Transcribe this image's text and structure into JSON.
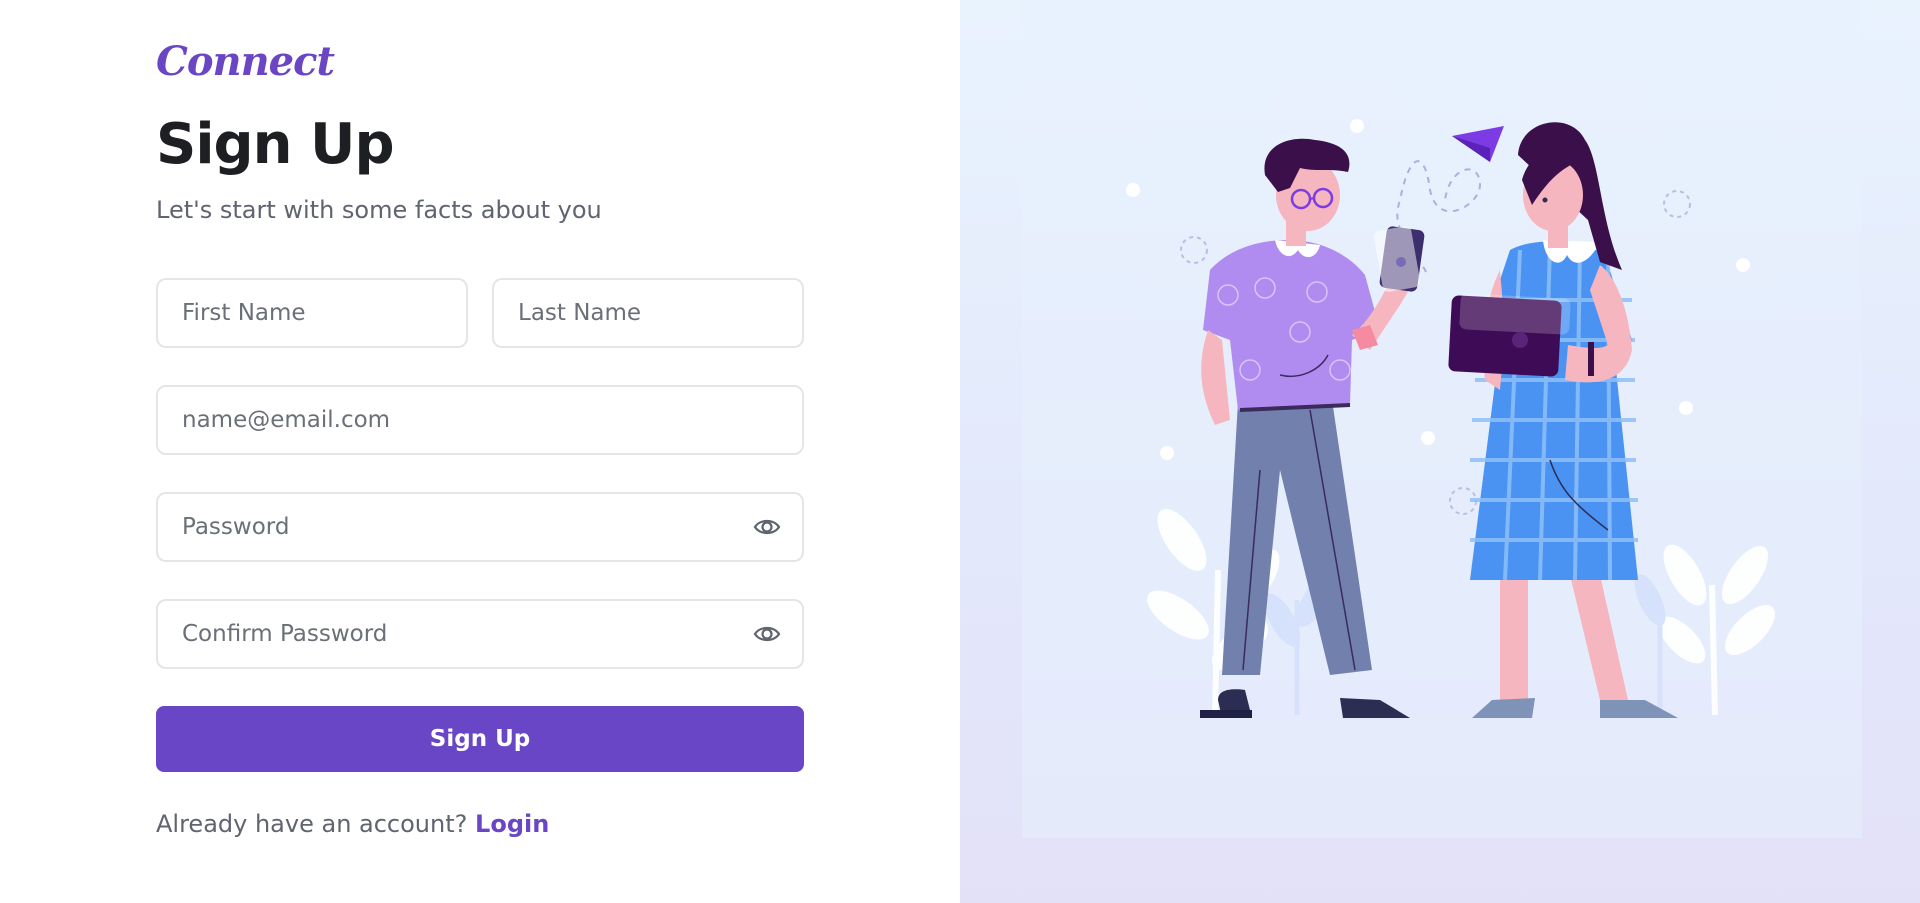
{
  "brand": {
    "logo_text": "Connect",
    "accent_color": "#6846c5"
  },
  "form": {
    "title": "Sign Up",
    "subtitle": "Let's start with some facts about you",
    "first_name": {
      "placeholder": "First Name",
      "value": ""
    },
    "last_name": {
      "placeholder": "Last Name",
      "value": ""
    },
    "email": {
      "placeholder": "name@email.com",
      "value": ""
    },
    "password": {
      "placeholder": "Password",
      "value": "",
      "toggle_icon": "eye-icon"
    },
    "confirm_password": {
      "placeholder": "Confirm Password",
      "value": "",
      "toggle_icon": "eye-icon"
    },
    "submit_label": "Sign Up"
  },
  "footer": {
    "prompt": "Already have an account?",
    "login_label": "Login"
  },
  "illustration": {
    "subject": "two-people-using-devices-illustration"
  }
}
